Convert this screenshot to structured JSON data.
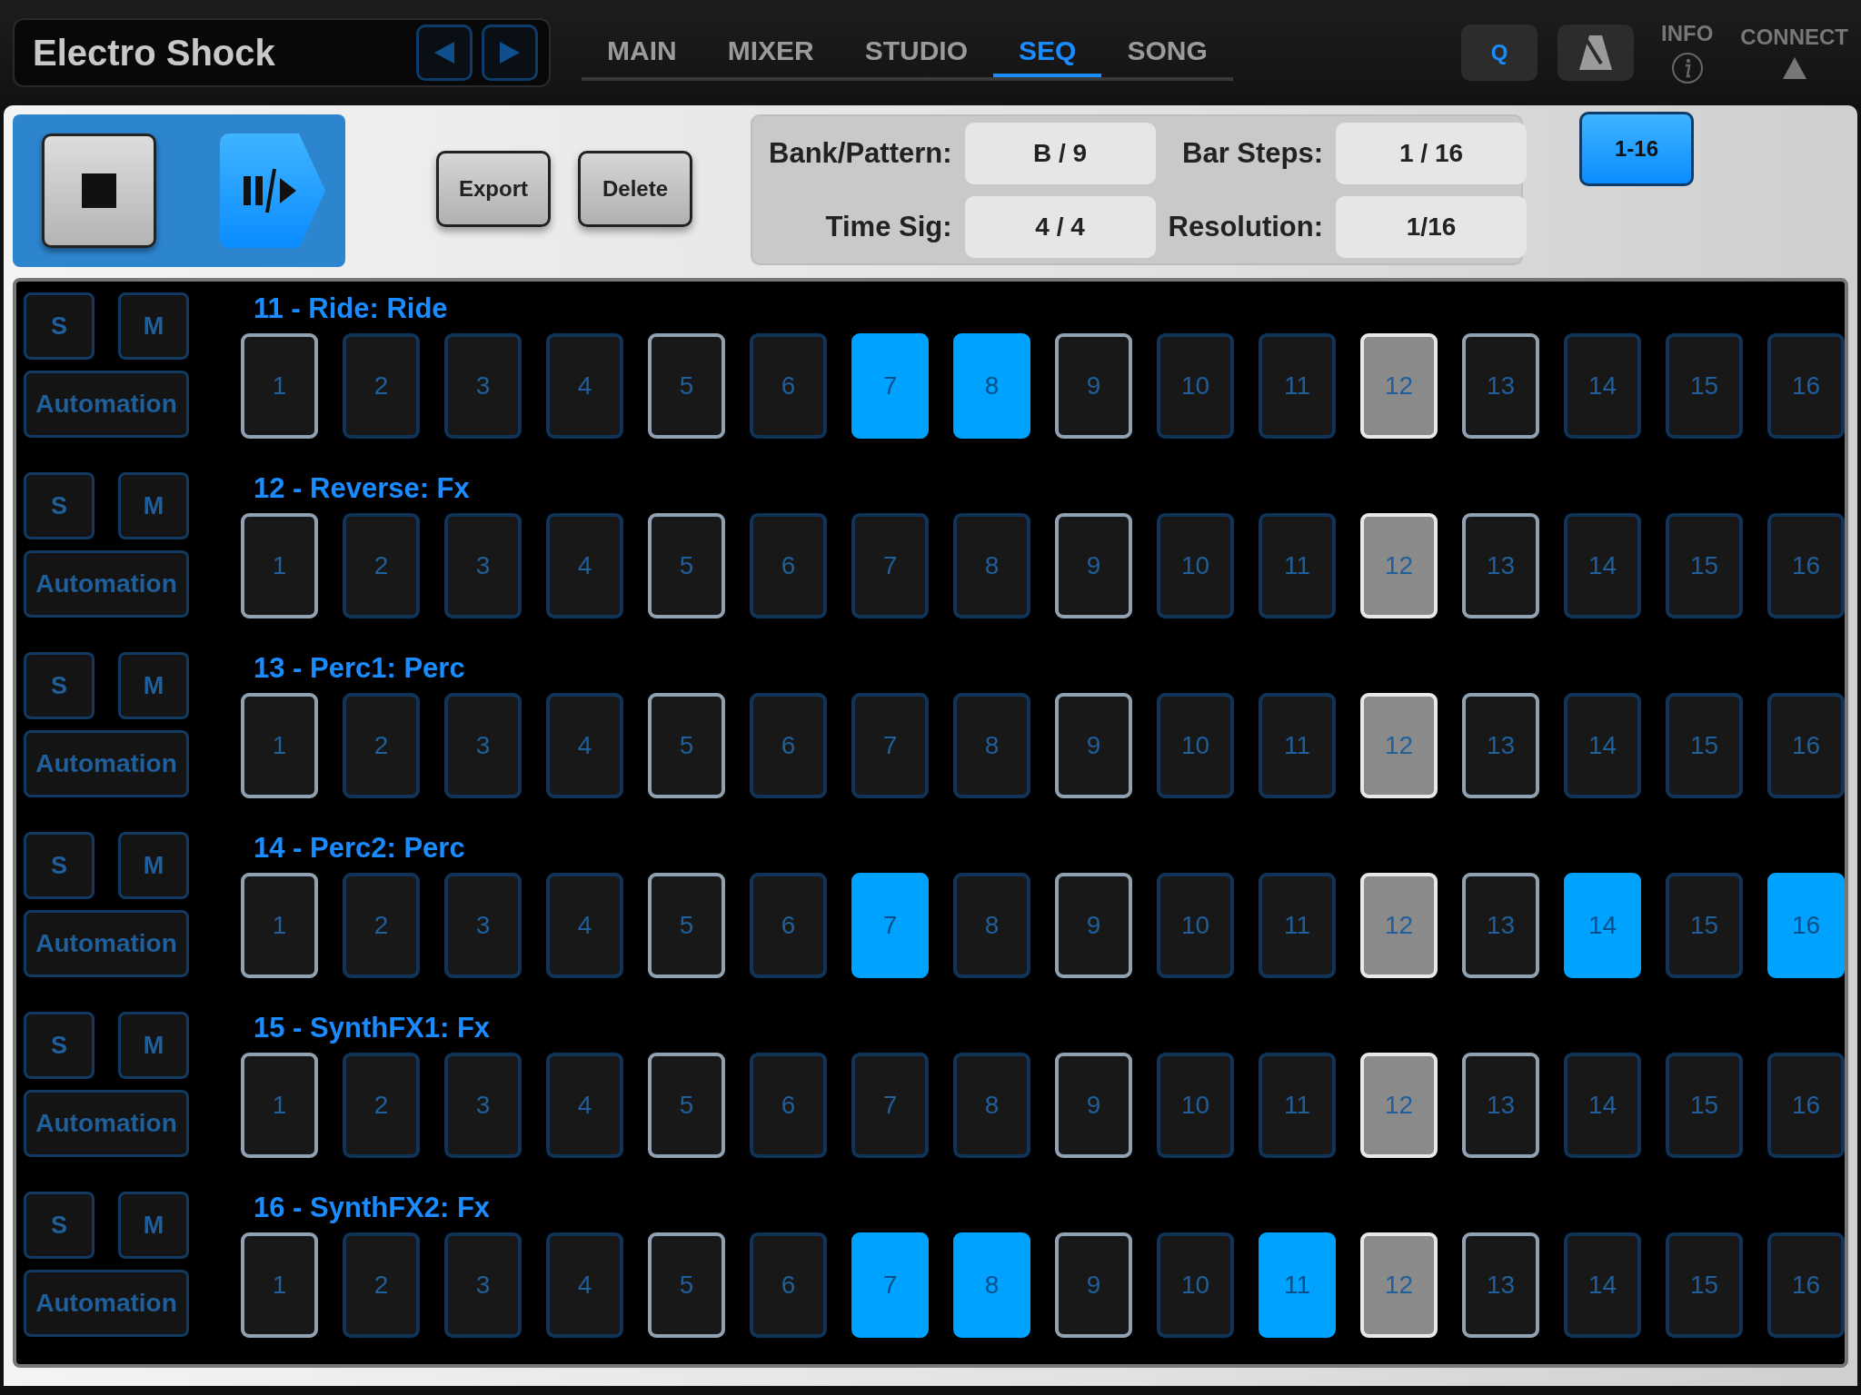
{
  "header": {
    "title": "Electro Shock",
    "tabs": [
      {
        "label": "MAIN",
        "selected": false
      },
      {
        "label": "MIXER",
        "selected": false
      },
      {
        "label": "STUDIO",
        "selected": false
      },
      {
        "label": "SEQ",
        "selected": true
      },
      {
        "label": "SONG",
        "selected": false
      }
    ],
    "quantize_label": "Q",
    "info_label": "INFO",
    "connect_label": "CONNECT"
  },
  "transport": {
    "playing": true
  },
  "actions": [
    "Export",
    "Delete"
  ],
  "pattern_info": [
    {
      "label": "Bank/Pattern:",
      "value": "B / 9"
    },
    {
      "label": "Bar Steps:",
      "value": "1 / 16"
    },
    {
      "label": "Time Sig:",
      "value": "4 / 4"
    },
    {
      "label": "Resolution:",
      "value": "1/16"
    }
  ],
  "bar_button": {
    "label": "1-16",
    "selected": true
  },
  "tracks": [
    {
      "name": "11 - Ride: Ride",
      "solo_label": "S",
      "mute_label": "M",
      "automation_label": "Automation",
      "steps": [
        {
          "label": "1",
          "on": false,
          "current": false
        },
        {
          "label": "2",
          "on": false,
          "current": false
        },
        {
          "label": "3",
          "on": false,
          "current": false
        },
        {
          "label": "4",
          "on": false,
          "current": false
        },
        {
          "label": "5",
          "on": false,
          "current": false
        },
        {
          "label": "6",
          "on": false,
          "current": false
        },
        {
          "label": "7",
          "on": true,
          "current": false
        },
        {
          "label": "8",
          "on": true,
          "current": false
        },
        {
          "label": "9",
          "on": false,
          "current": false
        },
        {
          "label": "10",
          "on": false,
          "current": false
        },
        {
          "label": "11",
          "on": false,
          "current": false
        },
        {
          "label": "12",
          "on": false,
          "current": true
        },
        {
          "label": "13",
          "on": false,
          "current": false
        },
        {
          "label": "14",
          "on": false,
          "current": false
        },
        {
          "label": "15",
          "on": false,
          "current": false
        },
        {
          "label": "16",
          "on": false,
          "current": false
        }
      ]
    },
    {
      "name": "12 - Reverse: Fx",
      "solo_label": "S",
      "mute_label": "M",
      "automation_label": "Automation",
      "steps": [
        {
          "label": "1",
          "on": false,
          "current": false
        },
        {
          "label": "2",
          "on": false,
          "current": false
        },
        {
          "label": "3",
          "on": false,
          "current": false
        },
        {
          "label": "4",
          "on": false,
          "current": false
        },
        {
          "label": "5",
          "on": false,
          "current": false
        },
        {
          "label": "6",
          "on": false,
          "current": false
        },
        {
          "label": "7",
          "on": false,
          "current": false
        },
        {
          "label": "8",
          "on": false,
          "current": false
        },
        {
          "label": "9",
          "on": false,
          "current": false
        },
        {
          "label": "10",
          "on": false,
          "current": false
        },
        {
          "label": "11",
          "on": false,
          "current": false
        },
        {
          "label": "12",
          "on": false,
          "current": true
        },
        {
          "label": "13",
          "on": false,
          "current": false
        },
        {
          "label": "14",
          "on": false,
          "current": false
        },
        {
          "label": "15",
          "on": false,
          "current": false
        },
        {
          "label": "16",
          "on": false,
          "current": false
        }
      ]
    },
    {
      "name": "13 - Perc1: Perc",
      "solo_label": "S",
      "mute_label": "M",
      "automation_label": "Automation",
      "steps": [
        {
          "label": "1",
          "on": false,
          "current": false
        },
        {
          "label": "2",
          "on": false,
          "current": false
        },
        {
          "label": "3",
          "on": false,
          "current": false
        },
        {
          "label": "4",
          "on": false,
          "current": false
        },
        {
          "label": "5",
          "on": false,
          "current": false
        },
        {
          "label": "6",
          "on": false,
          "current": false
        },
        {
          "label": "7",
          "on": false,
          "current": false
        },
        {
          "label": "8",
          "on": false,
          "current": false
        },
        {
          "label": "9",
          "on": false,
          "current": false
        },
        {
          "label": "10",
          "on": false,
          "current": false
        },
        {
          "label": "11",
          "on": false,
          "current": false
        },
        {
          "label": "12",
          "on": false,
          "current": true
        },
        {
          "label": "13",
          "on": false,
          "current": false
        },
        {
          "label": "14",
          "on": false,
          "current": false
        },
        {
          "label": "15",
          "on": false,
          "current": false
        },
        {
          "label": "16",
          "on": false,
          "current": false
        }
      ]
    },
    {
      "name": "14 - Perc2: Perc",
      "solo_label": "S",
      "mute_label": "M",
      "automation_label": "Automation",
      "steps": [
        {
          "label": "1",
          "on": false,
          "current": false
        },
        {
          "label": "2",
          "on": false,
          "current": false
        },
        {
          "label": "3",
          "on": false,
          "current": false
        },
        {
          "label": "4",
          "on": false,
          "current": false
        },
        {
          "label": "5",
          "on": false,
          "current": false
        },
        {
          "label": "6",
          "on": false,
          "current": false
        },
        {
          "label": "7",
          "on": true,
          "current": false
        },
        {
          "label": "8",
          "on": false,
          "current": false
        },
        {
          "label": "9",
          "on": false,
          "current": false
        },
        {
          "label": "10",
          "on": false,
          "current": false
        },
        {
          "label": "11",
          "on": false,
          "current": false
        },
        {
          "label": "12",
          "on": false,
          "current": true
        },
        {
          "label": "13",
          "on": false,
          "current": false
        },
        {
          "label": "14",
          "on": true,
          "current": false
        },
        {
          "label": "15",
          "on": false,
          "current": false
        },
        {
          "label": "16",
          "on": true,
          "current": false
        }
      ]
    },
    {
      "name": "15 - SynthFX1: Fx",
      "solo_label": "S",
      "mute_label": "M",
      "automation_label": "Automation",
      "steps": [
        {
          "label": "1",
          "on": false,
          "current": false
        },
        {
          "label": "2",
          "on": false,
          "current": false
        },
        {
          "label": "3",
          "on": false,
          "current": false
        },
        {
          "label": "4",
          "on": false,
          "current": false
        },
        {
          "label": "5",
          "on": false,
          "current": false
        },
        {
          "label": "6",
          "on": false,
          "current": false
        },
        {
          "label": "7",
          "on": false,
          "current": false
        },
        {
          "label": "8",
          "on": false,
          "current": false
        },
        {
          "label": "9",
          "on": false,
          "current": false
        },
        {
          "label": "10",
          "on": false,
          "current": false
        },
        {
          "label": "11",
          "on": false,
          "current": false
        },
        {
          "label": "12",
          "on": false,
          "current": true
        },
        {
          "label": "13",
          "on": false,
          "current": false
        },
        {
          "label": "14",
          "on": false,
          "current": false
        },
        {
          "label": "15",
          "on": false,
          "current": false
        },
        {
          "label": "16",
          "on": false,
          "current": false
        }
      ]
    },
    {
      "name": "16 - SynthFX2: Fx",
      "solo_label": "S",
      "mute_label": "M",
      "automation_label": "Automation",
      "steps": [
        {
          "label": "1",
          "on": false,
          "current": false
        },
        {
          "label": "2",
          "on": false,
          "current": false
        },
        {
          "label": "3",
          "on": false,
          "current": false
        },
        {
          "label": "4",
          "on": false,
          "current": false
        },
        {
          "label": "5",
          "on": false,
          "current": false
        },
        {
          "label": "6",
          "on": false,
          "current": false
        },
        {
          "label": "7",
          "on": true,
          "current": false
        },
        {
          "label": "8",
          "on": true,
          "current": false
        },
        {
          "label": "9",
          "on": false,
          "current": false
        },
        {
          "label": "10",
          "on": false,
          "current": false
        },
        {
          "label": "11",
          "on": true,
          "current": false
        },
        {
          "label": "12",
          "on": false,
          "current": true
        },
        {
          "label": "13",
          "on": false,
          "current": false
        },
        {
          "label": "14",
          "on": false,
          "current": false
        },
        {
          "label": "15",
          "on": false,
          "current": false
        },
        {
          "label": "16",
          "on": false,
          "current": false
        }
      ]
    }
  ]
}
